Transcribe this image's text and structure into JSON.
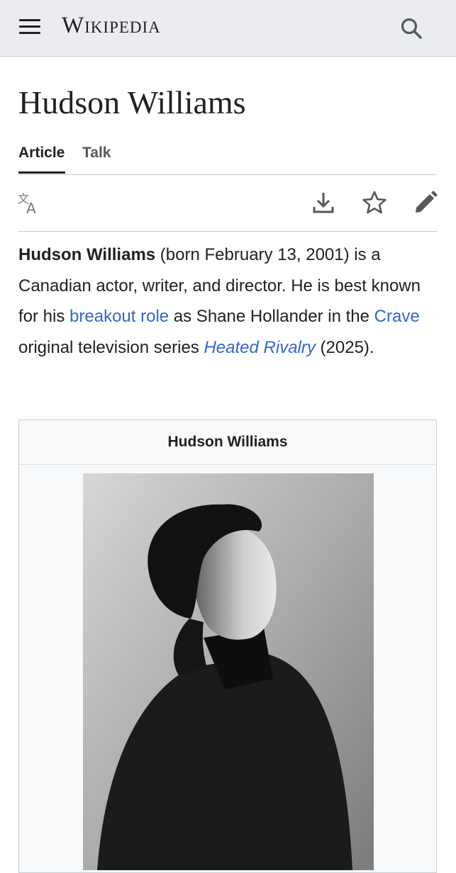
{
  "header": {
    "wordmark": "Wikipedia",
    "menu_icon": "hamburger-menu-icon",
    "search_icon": "search-icon"
  },
  "article": {
    "title": "Hudson Williams",
    "tabs": [
      {
        "label": "Article",
        "active": true
      },
      {
        "label": "Talk",
        "active": false
      }
    ]
  },
  "toolbar": {
    "icons": [
      "language-icon",
      "download-icon",
      "star-icon",
      "edit-pencil-icon"
    ]
  },
  "intro": {
    "name": "Hudson Williams",
    "text1": " (born February 13, 2001) is a Canadian actor, writer, and director. He is best known for his ",
    "link1": "breakout role",
    "text2": " as Shane Hollander in the ",
    "link2": "Crave",
    "text3": " original television series ",
    "link3": "Heated Rivalry",
    "text4": " (2025)."
  },
  "infobox": {
    "caption": "Hudson Williams"
  },
  "colors": {
    "link": "#3366cc",
    "header_bg": "#eaecf0",
    "text": "#202122"
  }
}
